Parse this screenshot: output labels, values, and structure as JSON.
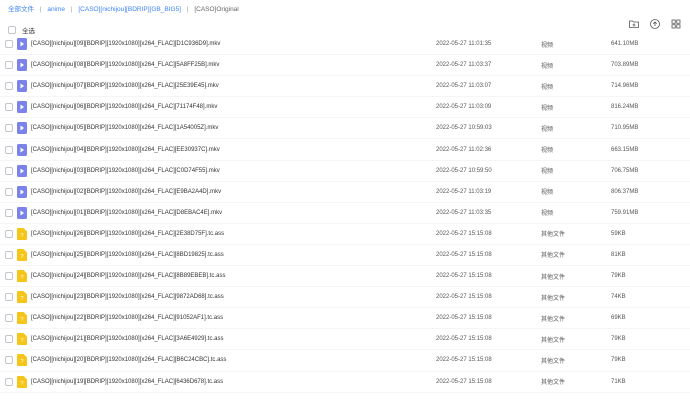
{
  "breadcrumb": {
    "items": [
      "全部文件",
      "anime",
      "[CASO][nichijou][BDRIP][GB_BIG5]",
      "[CASO]Original"
    ]
  },
  "toolbar": {
    "icons": [
      "new-folder-icon",
      "upload-icon",
      "grid-view-icon"
    ]
  },
  "selection": {
    "select_all_label": "全选"
  },
  "files": [
    {
      "name": "[CASO][nichijou][09][BDRIP][1920x1080][x264_FLAC][D1C936D9].mkv",
      "time": "2022-05-27 11:01:35",
      "type": "视频",
      "size": "641.10MB",
      "icon": "video-file-icon"
    },
    {
      "name": "[CASO][nichijou][08][BDRIP][1920x1080][x264_FLAC][5A8FF25B].mkv",
      "time": "2022-05-27 11:03:37",
      "type": "视频",
      "size": "703.89MB",
      "icon": "video-file-icon"
    },
    {
      "name": "[CASO][nichijou][07][BDRIP][1920x1080][x264_FLAC][25E39E45].mkv",
      "time": "2022-05-27 11:03:07",
      "type": "视频",
      "size": "714.96MB",
      "icon": "video-file-icon"
    },
    {
      "name": "[CASO][nichijou][06][BDRIP][1920x1080][x264_FLAC][71174F48].mkv",
      "time": "2022-05-27 11:03:09",
      "type": "视频",
      "size": "816.24MB",
      "icon": "video-file-icon"
    },
    {
      "name": "[CASO][nichijou][05][BDRIP][1920x1080][x264_FLAC][1A54005Z].mkv",
      "time": "2022-05-27 10:59:03",
      "type": "视频",
      "size": "710.95MB",
      "icon": "video-file-icon"
    },
    {
      "name": "[CASO][nichijou][04][BDRIP][1920x1080][x264_FLAC][EE30937C].mkv",
      "time": "2022-05-27 11:02:36",
      "type": "视频",
      "size": "663.15MB",
      "icon": "video-file-icon"
    },
    {
      "name": "[CASO][nichijou][03][BDRIP][1920x1080][x264_FLAC][C0D74F55].mkv",
      "time": "2022-05-27 10:59:50",
      "type": "视频",
      "size": "706.75MB",
      "icon": "video-file-icon"
    },
    {
      "name": "[CASO][nichijou][02][BDRIP][1920x1080][x264_FLAC][E9BA2A4D].mkv",
      "time": "2022-05-27 11:03:19",
      "type": "视频",
      "size": "806.37MB",
      "icon": "video-file-icon"
    },
    {
      "name": "[CASO][nichijou][01][BDRIP][1920x1080][x264_FLAC][D8EBAC4E].mkv",
      "time": "2022-05-27 11:03:35",
      "type": "视频",
      "size": "759.91MB",
      "icon": "video-file-icon"
    },
    {
      "name": "[CASO][nichijou][26][BDRIP][1920x1080][x264_FLAC][2E38D75F].tc.ass",
      "time": "2022-05-27 15:15:08",
      "type": "其他文件",
      "size": "59KB",
      "icon": "document-file-icon"
    },
    {
      "name": "[CASO][nichijou][25][BDRIP][1920x1080][x264_FLAC][8BD19825].tc.ass",
      "time": "2022-05-27 15:15:08",
      "type": "其他文件",
      "size": "81KB",
      "icon": "document-file-icon"
    },
    {
      "name": "[CASO][nichijou][24][BDRIP][1920x1080][x264_FLAC][8B89EBEB].tc.ass",
      "time": "2022-05-27 15:15:08",
      "type": "其他文件",
      "size": "79KB",
      "icon": "document-file-icon"
    },
    {
      "name": "[CASO][nichijou][23][BDRIP][1920x1080][x264_FLAC][9872AD68].tc.ass",
      "time": "2022-05-27 15:15:08",
      "type": "其他文件",
      "size": "74KB",
      "icon": "document-file-icon"
    },
    {
      "name": "[CASO][nichijou][22][BDRIP][1920x1080][x264_FLAC][91052AF1].tc.ass",
      "time": "2022-05-27 15:15:08",
      "type": "其他文件",
      "size": "69KB",
      "icon": "document-file-icon"
    },
    {
      "name": "[CASO][nichijou][21][BDRIP][1920x1080][x264_FLAC][3A6E4929].tc.ass",
      "time": "2022-05-27 15:15:08",
      "type": "其他文件",
      "size": "79KB",
      "icon": "document-file-icon"
    },
    {
      "name": "[CASO][nichijou][20][BDRIP][1920x1080][x264_FLAC][B6C24CBC].tc.ass",
      "time": "2022-05-27 15:15:08",
      "type": "其他文件",
      "size": "79KB",
      "icon": "document-file-icon"
    },
    {
      "name": "[CASO][nichijou][19][BDRIP][1920x1080][x264_FLAC][6436D678].tc.ass",
      "time": "2022-05-27 15:15:08",
      "type": "其他文件",
      "size": "71KB",
      "icon": "document-file-icon"
    }
  ],
  "colors": {
    "link": "#3b82f6",
    "video_icon": "#7b83eb",
    "document_icon": "#f5c518"
  }
}
